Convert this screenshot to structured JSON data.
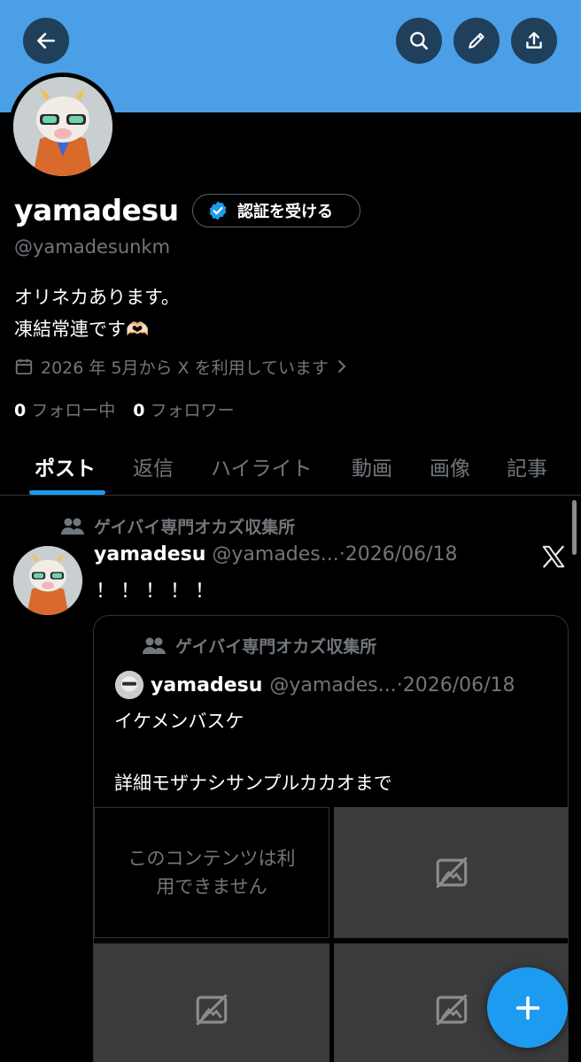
{
  "header": {
    "back_icon": "arrow-left-icon",
    "search_icon": "search-icon",
    "edit_icon": "pencil-icon",
    "share_icon": "share-icon",
    "banner_color": "#4a9fe6"
  },
  "profile": {
    "display_name": "yamadesu",
    "verify_label": "認証を受ける",
    "handle": "@yamadesunkm",
    "bio_line1": "オリネカあります。",
    "bio_line2": "凍結常連です🫶🏻",
    "joined": "2026 年 5月から X を利用しています",
    "following_count": "0",
    "following_label": "フォロー中",
    "followers_count": "0",
    "followers_label": "フォロワー"
  },
  "tabs": [
    {
      "label": "ポスト",
      "active": true
    },
    {
      "label": "返信"
    },
    {
      "label": "ハイライト"
    },
    {
      "label": "動画"
    },
    {
      "label": "画像"
    },
    {
      "label": "記事"
    }
  ],
  "post": {
    "community": "ゲイバイ専門オカズ収集所",
    "author": "yamadesu",
    "handle_date": "@yamades...·2026/06/18",
    "text": "！！！！！",
    "quote": {
      "community": "ゲイバイ専門オカズ収集所",
      "author": "yamadesu",
      "handle_date": "@yamades...·2026/06/18",
      "line1": "イケメンバスケ",
      "line2": "詳細モザナシサンプルカカオまで",
      "unavailable_line1": "このコンテンツは利",
      "unavailable_line2": "用できません"
    }
  },
  "accent_color": "#1d9bf0",
  "fab_icon": "plus-icon"
}
